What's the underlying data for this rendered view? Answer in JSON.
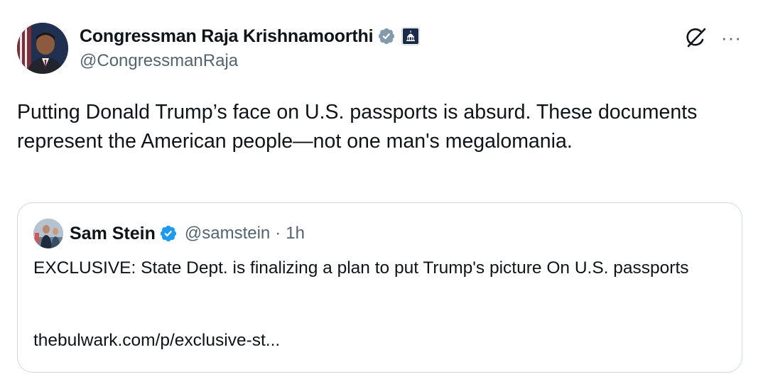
{
  "author": {
    "display_name": "Congressman Raja Krishnamoorthi",
    "handle": "@CongressmanRaja",
    "verified_badge_color": "#829aab",
    "affiliation_icon": "capitol-building-icon"
  },
  "actions": {
    "grok_icon": "grok-icon",
    "more_icon": "more-icon",
    "more_label": "···"
  },
  "tweet": {
    "text": "Putting Donald Trump’s face on U.S. passports is absurd. These documents represent the American people—not one man's megalomania."
  },
  "quoted_tweet": {
    "display_name": "Sam Stein",
    "handle": "@samstein",
    "separator": "·",
    "time": "1h",
    "verified_badge_color": "#1d9bf0",
    "text": "EXCLUSIVE: State Dept. is finalizing a plan to put Trump's picture On U.S. passports",
    "link": "thebulwark.com/p/exclusive-st..."
  }
}
